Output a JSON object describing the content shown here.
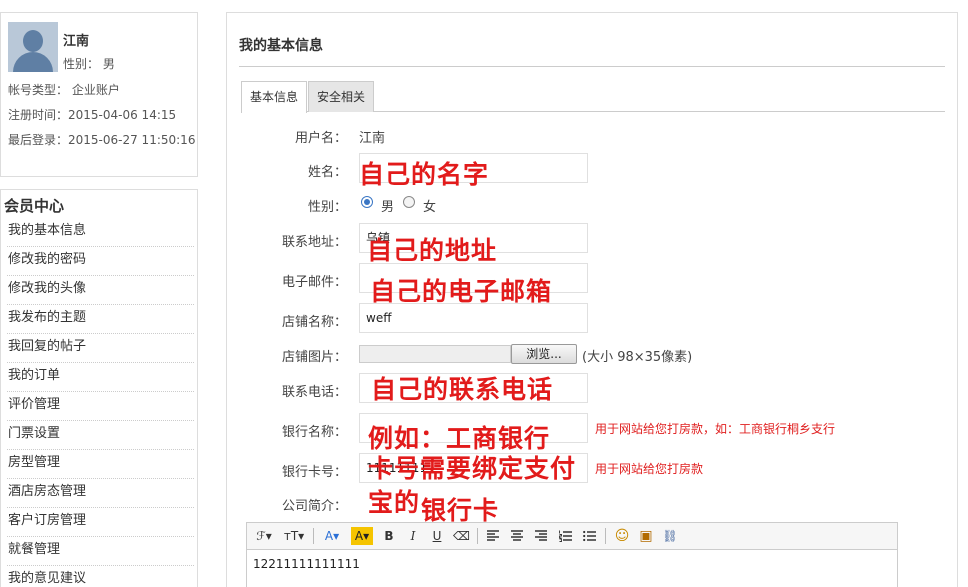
{
  "profile": {
    "name": "江南",
    "gender_line": "性别： 男",
    "account_type_line": "帐号类型： 企业账户",
    "register_line": "注册时间：2015-04-06 14:15",
    "last_login_line": "最后登录：2015-06-27 11:50:16"
  },
  "member_center": {
    "title": "会员中心",
    "items": [
      "我的基本信息",
      "修改我的密码",
      "修改我的头像",
      "我发布的主题",
      "我回复的帖子",
      "我的订单",
      "评价管理",
      "门票设置",
      "房型管理",
      "酒店房态管理",
      "客户订房管理",
      "就餐管理",
      "我的意见建议"
    ]
  },
  "main": {
    "title": "我的基本信息",
    "tabs": [
      "基本信息",
      "安全相关"
    ],
    "form": {
      "username_label": "用户名：",
      "username_value": "江南",
      "realname_label": "姓名：",
      "realname_value": "",
      "gender_label": "性别：",
      "gender_options": [
        "男",
        "女"
      ],
      "gender_selected": "男",
      "address_label": "联系地址：",
      "address_value": "乌镇",
      "email_label": "电子邮件：",
      "email_value": "",
      "shop_name_label": "店铺名称：",
      "shop_name_value": "weff",
      "shop_image_label": "店铺图片：",
      "browse_label": "浏览...",
      "shop_image_hint": "(大小 98×35像素)",
      "phone_label": "联系电话：",
      "phone_value": "",
      "bank_name_label": "银行名称：",
      "bank_name_value": "",
      "bank_name_hint": "用于网站给您打房款，如：工商银行桐乡支行",
      "bank_card_label": "银行卡号：",
      "bank_card_value": "11111111",
      "bank_card_hint": "用于网站给您打房款",
      "intro_label": "公司简介：",
      "intro_value": "12211111111111"
    },
    "annotations": {
      "name": "自己的名字",
      "address": "自己的地址",
      "email": "自己的电子邮箱",
      "phone": "自己的联系电话",
      "bank_example": "例如：工商银行",
      "card_need": "卡号需要绑定支付",
      "card_need_2": "宝的",
      "card_bank": "银行卡"
    },
    "editor_toolbar": {
      "font_family": "ℱ▾",
      "font_size": "тT▾",
      "font_color": "A▾",
      "highlight": "A▾",
      "bold": "B",
      "italic": "I",
      "underline": "U",
      "eraser": "⌫",
      "emoji": "☺",
      "image": "▣",
      "link": "⛓"
    }
  },
  "colors": {
    "annotation_red": "#e21b1b",
    "hint_red": "#e02020",
    "radio_blue": "#3a76c4",
    "highlight_yellow": "#f5c400",
    "font_color_blue": "#2a6fd6"
  }
}
